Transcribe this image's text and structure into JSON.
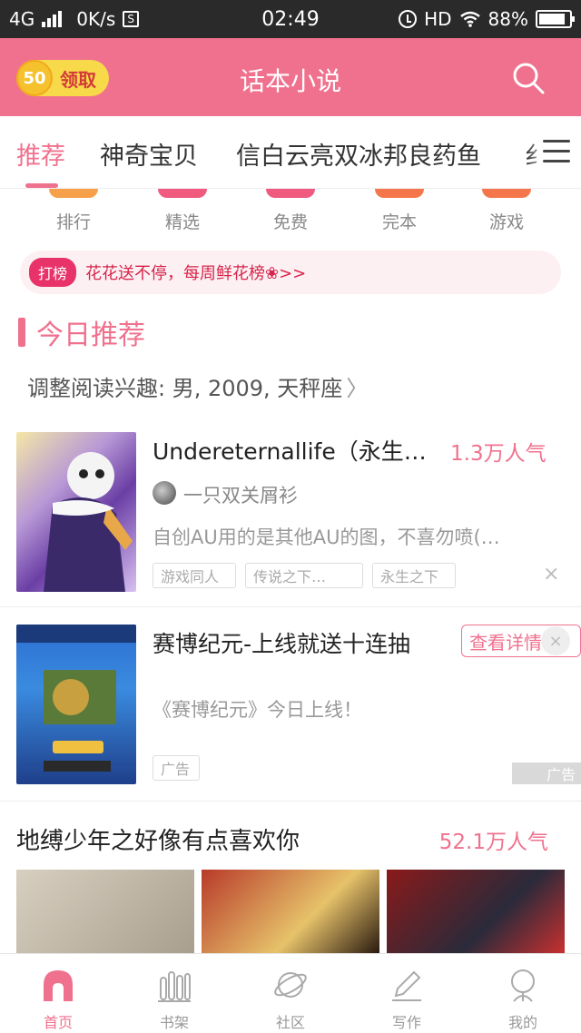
{
  "status_bar": {
    "network": "4G",
    "speed": "0K/s",
    "sim_icon": "S",
    "time": "02:49",
    "hd": "HD",
    "battery": "88%",
    "battery_level": 0.88
  },
  "header": {
    "coins": "50",
    "claim_label": "领取",
    "title": "话本小说",
    "search_icon": "search-icon"
  },
  "tabs": [
    "推荐",
    "神奇宝贝",
    "信白云亮双冰邦良药鱼",
    "纟"
  ],
  "quick_nav": [
    "排行",
    "精选",
    "免费",
    "完本",
    "游戏"
  ],
  "notice": {
    "tag": "打榜",
    "text": "花花送不停，每周鲜花榜❀>>"
  },
  "section": {
    "title": "今日推荐",
    "interest": "调整阅读兴趣: 男, 2009, 天秤座",
    "interest_chevron": "〉"
  },
  "story": {
    "title": "Undereternallife（永生…",
    "popularity": "1.3万人气",
    "author": "一只双关屑衫",
    "desc": "自创AU用的是其他AU的图，不喜勿喷(…",
    "tags": [
      "游戏同人",
      "传说之下…",
      "永生之下"
    ],
    "dismiss": "×"
  },
  "ad": {
    "title": "赛博纪元-上线就送十连抽",
    "button": "查看详情",
    "desc": "《赛博纪元》今日上线！",
    "tag": "广告",
    "mark": "广告",
    "close": "×"
  },
  "collection": {
    "title": "地缚少年之好像有点喜欢你",
    "popularity": "52.1万人气"
  },
  "bottom_nav": [
    "首页",
    "书架",
    "社区",
    "写作",
    "我的"
  ],
  "colors": {
    "brand": "#f0718e",
    "notice_tag": "#e8336a"
  }
}
